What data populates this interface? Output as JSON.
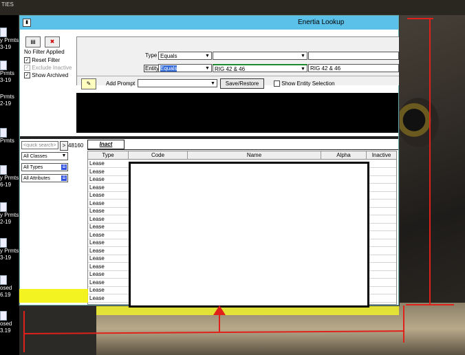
{
  "desktop": {
    "top_label": "TIES",
    "icons": [
      {
        "label": "y Prmts",
        "sub": "3-19"
      },
      {
        "label": "Prmts",
        "sub": "3-19"
      },
      {
        "label": "",
        "sub": "3-19"
      },
      {
        "label": "Prmts",
        "sub": "2-19"
      },
      {
        "label": "Prmts",
        "sub": ""
      },
      {
        "label": "y Prmts",
        "sub": "6-19"
      },
      {
        "label": "y Prmts",
        "sub": "2-19"
      },
      {
        "label": "y Prmts",
        "sub": "3-19"
      },
      {
        "label": "osed",
        "sub": "6.19"
      },
      {
        "label": "osed",
        "sub": "3.19"
      }
    ]
  },
  "window": {
    "title": "Enertia Lookup",
    "filter_status": "No Filter Applied",
    "reset_filter_label": "Reset Filter",
    "exclude_inactive_label": "Exclude Inactive",
    "show_archived_label": "Show Archived",
    "type_label": "Type",
    "type_operator": "Equals",
    "type_value": "",
    "type_value2": "",
    "entity_label": "Entity",
    "entity_operator": "Equals",
    "entity_value": "RIG 42 & 46",
    "entity_value2": "RIG 42 & 46",
    "add_prompt_label": "Add Prompt",
    "add_prompt_value": "",
    "save_restore_label": "Save/Restore",
    "show_entity_selection_label": "Show Entity Selection",
    "quick_search_placeholder": "<quick search>",
    "quick_go": ">",
    "count": "48160",
    "classes_value": "All Classes",
    "types_value": "All Types",
    "attributes_value": "All Attributes",
    "tab_label": "Inact",
    "columns": [
      "Type",
      "Code",
      "Name",
      "Alpha",
      "Inactive"
    ],
    "rows": [
      "Lease",
      "Lease",
      "Lease",
      "Lease",
      "Lease",
      "Lease",
      "Lease",
      "Lease",
      "Lease",
      "Lease",
      "Lease",
      "Lease",
      "Lease",
      "Lease",
      "Lease",
      "Lease",
      "Lease",
      "Lease"
    ]
  },
  "colors": {
    "titlebar": "#5bc1e8",
    "highlight": "#f2f20a",
    "annotation": "#e0201a"
  }
}
